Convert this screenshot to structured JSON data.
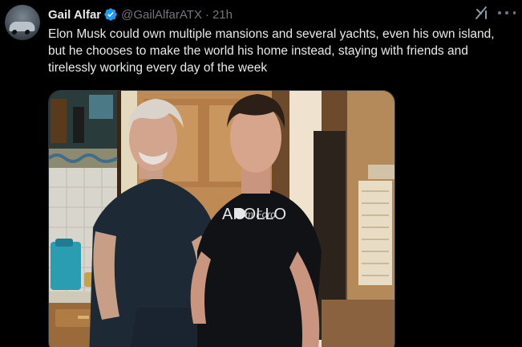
{
  "author": {
    "display_name": "Gail Alfar",
    "handle": "@GailAlfarATX",
    "separator": "·",
    "timestamp": "21h",
    "verified": true,
    "avatar_icon": "car-avatar"
  },
  "post": {
    "text": "Elon Musk could own multiple mansions and several yachts, even his own island, but he chooses to make the world his home instead, staying with friends and tirelessly working every day of the week"
  },
  "media": {
    "shirt_text": "APOLLO",
    "shirt_script": "Tom Ford"
  },
  "icons": {
    "grok": "grok-icon",
    "more": "more-icon",
    "verified": "verified-badge-icon"
  },
  "colors": {
    "background": "#000000",
    "primary_text": "#e7e9ea",
    "secondary_text": "#71767b",
    "verified_blue": "#1d9bf0"
  }
}
